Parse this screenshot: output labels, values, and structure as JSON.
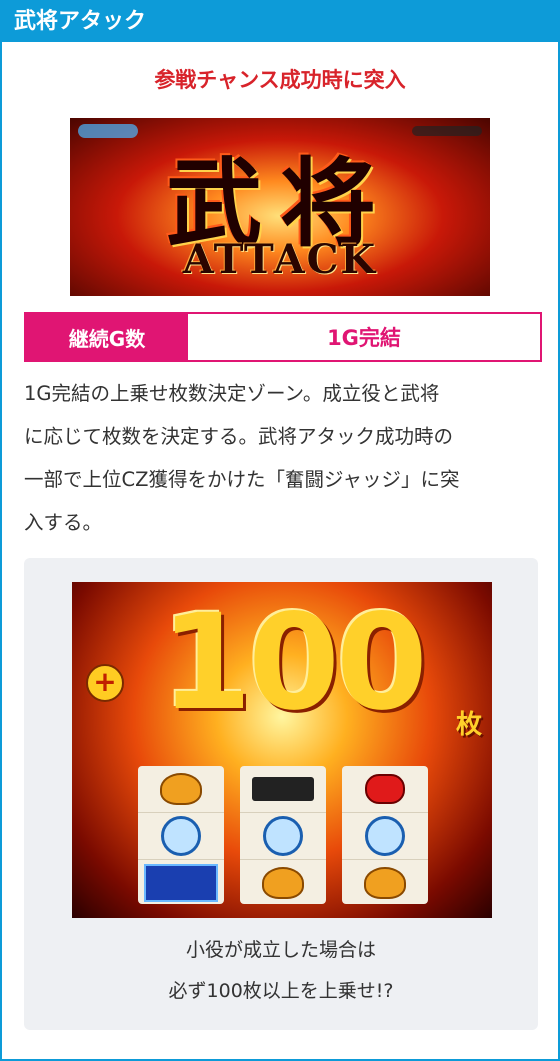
{
  "header": {
    "title": "武将アタック"
  },
  "subtitle": "参戦チャンス成功時に突入",
  "banner": {
    "kanji": "武将",
    "word": "ATTACK"
  },
  "info": {
    "label": "継続G数",
    "value": "1G完結"
  },
  "description": [
    "1G完結の上乗せ枚数決定ゾーン。成立役と武将",
    "に応じて枚数を決定する。武将アタック成功時の",
    "一部で上位CZ獲得をかけた「奮闘ジャッジ」に突",
    "入する。"
  ],
  "screen": {
    "plus": "+",
    "number": "100",
    "unit": "枚",
    "reels": [
      [
        "bell-symbol",
        "blue-emblem-symbol",
        "blue-bar-symbol"
      ],
      [
        "dark-vs-symbol",
        "blue-emblem-symbol",
        "bell-symbol"
      ],
      [
        "cherry-symbol",
        "blue-emblem-symbol",
        "bell-symbol"
      ]
    ]
  },
  "caption": [
    "小役が成立した場合は",
    "必ず100枚以上を上乗せ!?"
  ],
  "colors": {
    "header": "#0d9bd8",
    "subtitle": "#d8232a",
    "accent": "#e01573"
  }
}
